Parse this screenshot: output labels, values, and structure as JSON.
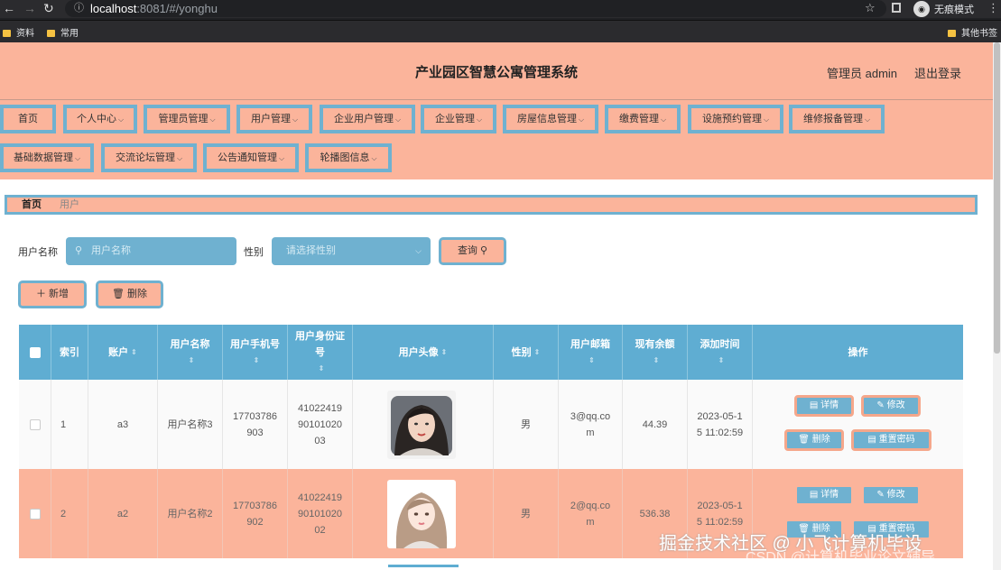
{
  "browser": {
    "url_host": "localhost",
    "url_rest": ":8081/#/yonghu",
    "incognito_label": "无痕模式",
    "bookmarks": [
      "资料",
      "常用"
    ],
    "other_bookmarks": "其他书签"
  },
  "header": {
    "title": "产业园区智慧公寓管理系统",
    "admin": "管理员 admin",
    "logout": "退出登录"
  },
  "nav": [
    "首页",
    "个人中心",
    "管理员管理",
    "用户管理",
    "企业用户管理",
    "企业管理",
    "房屋信息管理",
    "缴费管理",
    "设施预约管理",
    "维修报备管理",
    "基础数据管理",
    "交流论坛管理",
    "公告通知管理",
    "轮播图信息"
  ],
  "breadcrumb": [
    "首页",
    "用户"
  ],
  "search": {
    "name_label": "用户名称",
    "name_placeholder": "用户名称",
    "gender_label": "性别",
    "gender_placeholder": "请选择性别",
    "query": "查询"
  },
  "toolbar": {
    "add": "新增",
    "delete": "删除"
  },
  "table": {
    "headers": [
      "索引",
      "账户",
      "用户名称",
      "用户手机号",
      "用户身份证号",
      "用户头像",
      "性别",
      "用户邮箱",
      "现有余额",
      "添加时间",
      "操作"
    ],
    "rows": [
      {
        "index": "1",
        "account": "a3",
        "name": "用户名称3",
        "phone": [
          "17703786",
          "903"
        ],
        "idcard": [
          "41022419",
          "90101020",
          "03"
        ],
        "gender": "男",
        "email": [
          "3@qq.co",
          "m"
        ],
        "balance": "44.39",
        "time": [
          "2023-05-1",
          "5 11:02:59"
        ]
      },
      {
        "index": "2",
        "account": "a2",
        "name": "用户名称2",
        "phone": [
          "17703786",
          "902"
        ],
        "idcard": [
          "41022419",
          "90101020",
          "02"
        ],
        "gender": "男",
        "email": [
          "2@qq.co",
          "m"
        ],
        "balance": "536.38",
        "time": [
          "2023-05-1",
          "5 11:02:59"
        ]
      }
    ],
    "actions": {
      "detail": "详情",
      "edit": "修改",
      "delete": "删除",
      "reset": "重置密码"
    }
  },
  "watermark": {
    "line1": "掘金技术社区 @ 小飞计算机毕设",
    "line2": "CSDN @计算机毕业论文辅导"
  },
  "colors": {
    "accent": "#6fb1d0",
    "salmon": "#fbb49b",
    "table_head": "#5fadd2"
  }
}
